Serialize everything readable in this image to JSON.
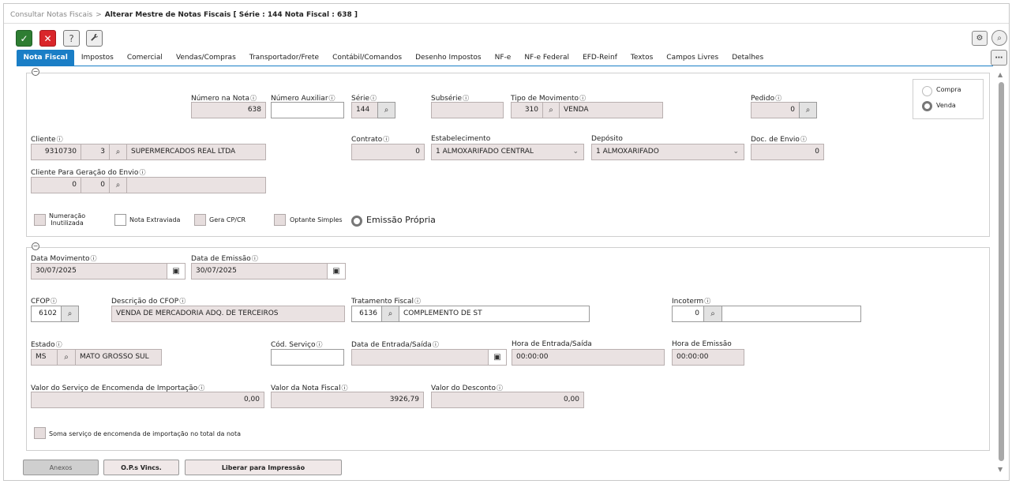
{
  "breadcrumb": {
    "parent": "Consultar Notas Fiscais",
    "separator": ">",
    "current": "Alterar Mestre de Notas Fiscais [ Série : 144 Nota Fiscal : 638 ]"
  },
  "toolbar": {
    "ok": "✓",
    "cancel": "✕",
    "help": "?",
    "tools": "🔧",
    "settings": "⚙",
    "search": "⌕",
    "more": "⋯"
  },
  "tabs": [
    "Nota Fiscal",
    "Impostos",
    "Comercial",
    "Vendas/Compras",
    "Transportador/Frete",
    "Contábil/Comandos",
    "Desenho Impostos",
    "NF-e",
    "NF-e Federal",
    "EFD-Reinf",
    "Textos",
    "Campos Livres",
    "Detalhes"
  ],
  "info_icon": "ⓘ",
  "section1": {
    "numero_na_nota": {
      "label": "Número na Nota",
      "value": "638"
    },
    "numero_auxiliar": {
      "label": "Número Auxiliar",
      "value": ""
    },
    "serie": {
      "label": "Série",
      "value": "144"
    },
    "subserie": {
      "label": "Subsérie",
      "value": ""
    },
    "tipo_movimento": {
      "label": "Tipo de Movimento",
      "code": "310",
      "desc": "VENDA"
    },
    "pedido": {
      "label": "Pedido",
      "value": "0"
    },
    "compra_label": "Compra",
    "venda_label": "Venda",
    "cliente": {
      "label": "Cliente",
      "code": "9310730",
      "seq": "3",
      "name": "SUPERMERCADOS REAL LTDA"
    },
    "contrato": {
      "label": "Contrato",
      "value": "0"
    },
    "estabelecimento": {
      "label": "Estabelecimento",
      "value": "1 ALMOXARIFADO CENTRAL"
    },
    "deposito": {
      "label": "Depósito",
      "value": "1 ALMOXARIFADO"
    },
    "doc_envio": {
      "label": "Doc. de Envio",
      "value": "0"
    },
    "cliente_envio": {
      "label": "Cliente Para Geração do Envio",
      "code": "0",
      "seq": "0",
      "name": ""
    },
    "chk_numeracao": "Numeração\nInutilizada",
    "chk_nota_extraviada": "Nota Extraviada",
    "chk_gera_cp": "Gera CP/CR",
    "chk_optante": "Optante Simples",
    "emissao_propria": "Emissão Própria"
  },
  "section2": {
    "data_movimento": {
      "label": "Data Movimento",
      "value": "30/07/2025"
    },
    "data_emissao": {
      "label": "Data de Emissão",
      "value": "30/07/2025"
    },
    "cfop": {
      "label": "CFOP",
      "value": "6102"
    },
    "desc_cfop": {
      "label": "Descrição do CFOP",
      "value": "VENDA DE MERCADORIA ADQ. DE TERCEIROS"
    },
    "tratamento_fiscal": {
      "label": "Tratamento Fiscal",
      "code": "6136",
      "desc": "COMPLEMENTO DE ST"
    },
    "incoterm": {
      "label": "Incoterm",
      "value": "0"
    },
    "estado": {
      "label": "Estado",
      "code": "MS",
      "name": "MATO GROSSO SUL"
    },
    "cod_servico": {
      "label": "Cód. Serviço",
      "value": ""
    },
    "data_entrada_saida": {
      "label": "Data de Entrada/Saída",
      "value": ""
    },
    "hora_entrada_saida": {
      "label": "Hora de Entrada/Saída",
      "value": "00:00:00"
    },
    "hora_emissao": {
      "label": "Hora de Emissão",
      "value": "00:00:00"
    },
    "valor_servico_importacao": {
      "label": "Valor do Serviço de Encomenda de Importação",
      "value": "0,00"
    },
    "valor_nota": {
      "label": "Valor da Nota Fiscal",
      "value": "3926,79"
    },
    "valor_desconto": {
      "label": "Valor do Desconto",
      "value": "0,00"
    },
    "chk_soma": "Soma serviço de encomenda de importação no total da nota"
  },
  "footer": {
    "anexos": "Anexos",
    "ops": "O.P.s Vincs.",
    "liberar": "Liberar para Impressão"
  }
}
